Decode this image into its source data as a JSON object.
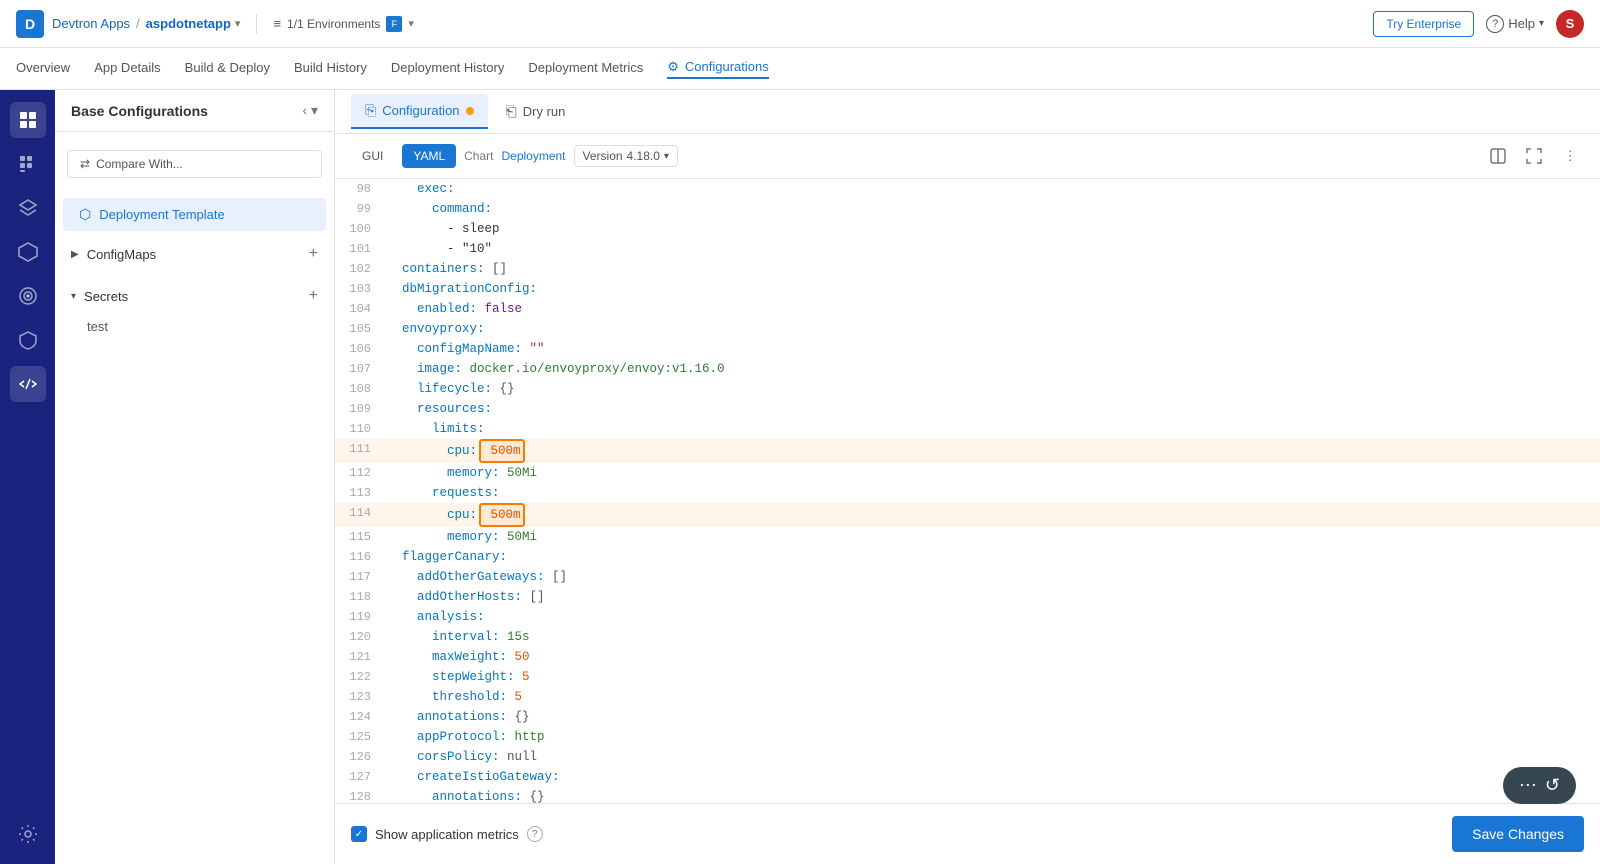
{
  "app": {
    "brand": "Devtron Apps",
    "separator": "/",
    "app_name": "aspdotnetapp",
    "logo_letter": "D"
  },
  "env": {
    "label": "1/1 Environments",
    "badge": "F"
  },
  "top_nav": {
    "try_enterprise": "Try Enterprise",
    "help": "Help",
    "user_initial": "S"
  },
  "secondary_nav": {
    "items": [
      {
        "id": "overview",
        "label": "Overview"
      },
      {
        "id": "app-details",
        "label": "App Details"
      },
      {
        "id": "build-deploy",
        "label": "Build & Deploy"
      },
      {
        "id": "build-history",
        "label": "Build History"
      },
      {
        "id": "deployment-history",
        "label": "Deployment History"
      },
      {
        "id": "deployment-metrics",
        "label": "Deployment Metrics"
      },
      {
        "id": "configurations",
        "label": "Configurations",
        "active": true
      }
    ]
  },
  "config_sidebar": {
    "title": "Base Configurations",
    "compare_btn": "Compare With...",
    "sections": [
      {
        "id": "deployment-template",
        "label": "Deployment Template",
        "active": true,
        "has_add": false
      },
      {
        "id": "configmaps",
        "label": "ConfigMaps",
        "active": false,
        "has_add": true
      },
      {
        "id": "secrets",
        "label": "Secrets",
        "active": false,
        "has_add": true,
        "children": [
          "test"
        ]
      }
    ]
  },
  "editor": {
    "tabs": [
      {
        "id": "configuration",
        "label": "Configuration",
        "active": true,
        "has_dot": true
      },
      {
        "id": "dry-run",
        "label": "Dry run",
        "active": false
      }
    ],
    "toolbar": {
      "gui_btn": "GUI",
      "yaml_btn": "YAML",
      "chart_label": "Chart",
      "deployment_label": "Deployment",
      "version_label": "Version",
      "version_value": "4.18.0"
    },
    "code_lines": [
      {
        "num": 98,
        "content": "    exec:",
        "type": "normal"
      },
      {
        "num": 99,
        "content": "      command:",
        "type": "normal"
      },
      {
        "num": 100,
        "content": "        - sleep",
        "type": "normal"
      },
      {
        "num": 101,
        "content": "        - \"10\"",
        "type": "normal"
      },
      {
        "num": 102,
        "content": "  containers: []",
        "type": "normal"
      },
      {
        "num": 103,
        "content": "  dbMigrationConfig:",
        "type": "normal"
      },
      {
        "num": 104,
        "content": "    enabled: false",
        "type": "normal"
      },
      {
        "num": 105,
        "content": "  envoyproxy:",
        "type": "normal"
      },
      {
        "num": 106,
        "content": "    configMapName: \"\"",
        "type": "normal"
      },
      {
        "num": 107,
        "content": "    image: docker.io/envoyproxy/envoy:v1.16.0",
        "type": "normal"
      },
      {
        "num": 108,
        "content": "    lifecycle: {}",
        "type": "normal"
      },
      {
        "num": 109,
        "content": "    resources:",
        "type": "normal"
      },
      {
        "num": 110,
        "content": "      limits:",
        "type": "normal"
      },
      {
        "num": 111,
        "content": "        cpu: 500m",
        "type": "highlighted"
      },
      {
        "num": 112,
        "content": "        memory: 50Mi",
        "type": "normal"
      },
      {
        "num": 113,
        "content": "      requests:",
        "type": "normal"
      },
      {
        "num": 114,
        "content": "        cpu: 500m",
        "type": "highlighted"
      },
      {
        "num": 115,
        "content": "        memory: 50Mi",
        "type": "normal"
      },
      {
        "num": 116,
        "content": "  flaggerCanary:",
        "type": "normal"
      },
      {
        "num": 117,
        "content": "    addOtherGateways: []",
        "type": "normal"
      },
      {
        "num": 118,
        "content": "    addOtherHosts: []",
        "type": "normal"
      },
      {
        "num": 119,
        "content": "    analysis:",
        "type": "normal"
      },
      {
        "num": 120,
        "content": "      interval: 15s",
        "type": "normal"
      },
      {
        "num": 121,
        "content": "      maxWeight: 50",
        "type": "normal"
      },
      {
        "num": 122,
        "content": "      stepWeight: 5",
        "type": "normal"
      },
      {
        "num": 123,
        "content": "      threshold: 5",
        "type": "normal"
      },
      {
        "num": 124,
        "content": "    annotations: {}",
        "type": "normal"
      },
      {
        "num": 125,
        "content": "    appProtocol: http",
        "type": "normal"
      },
      {
        "num": 126,
        "content": "    corsPolicy: null",
        "type": "normal"
      },
      {
        "num": 127,
        "content": "    createIstioGateway:",
        "type": "normal"
      },
      {
        "num": 128,
        "content": "      annotations: {}",
        "type": "normal"
      }
    ]
  },
  "footer": {
    "show_metrics_label": "Show application metrics",
    "save_btn": "Save Changes"
  },
  "sidebar_icons": [
    {
      "id": "grid",
      "symbol": "⊞",
      "active": true
    },
    {
      "id": "apps",
      "symbol": "▦",
      "active": false
    },
    {
      "id": "layers",
      "symbol": "◫",
      "active": false
    },
    {
      "id": "cube",
      "symbol": "⬡",
      "active": false
    },
    {
      "id": "target",
      "symbol": "◎",
      "active": false
    },
    {
      "id": "shield",
      "symbol": "⛨",
      "active": false
    },
    {
      "id": "code",
      "symbol": "</>",
      "active": true
    },
    {
      "id": "gear",
      "symbol": "⚙",
      "active": false
    }
  ],
  "colors": {
    "primary": "#1976d2",
    "brand_dark": "#1a237e",
    "highlight_orange": "#f57c00",
    "user_avatar_bg": "#c62828"
  }
}
